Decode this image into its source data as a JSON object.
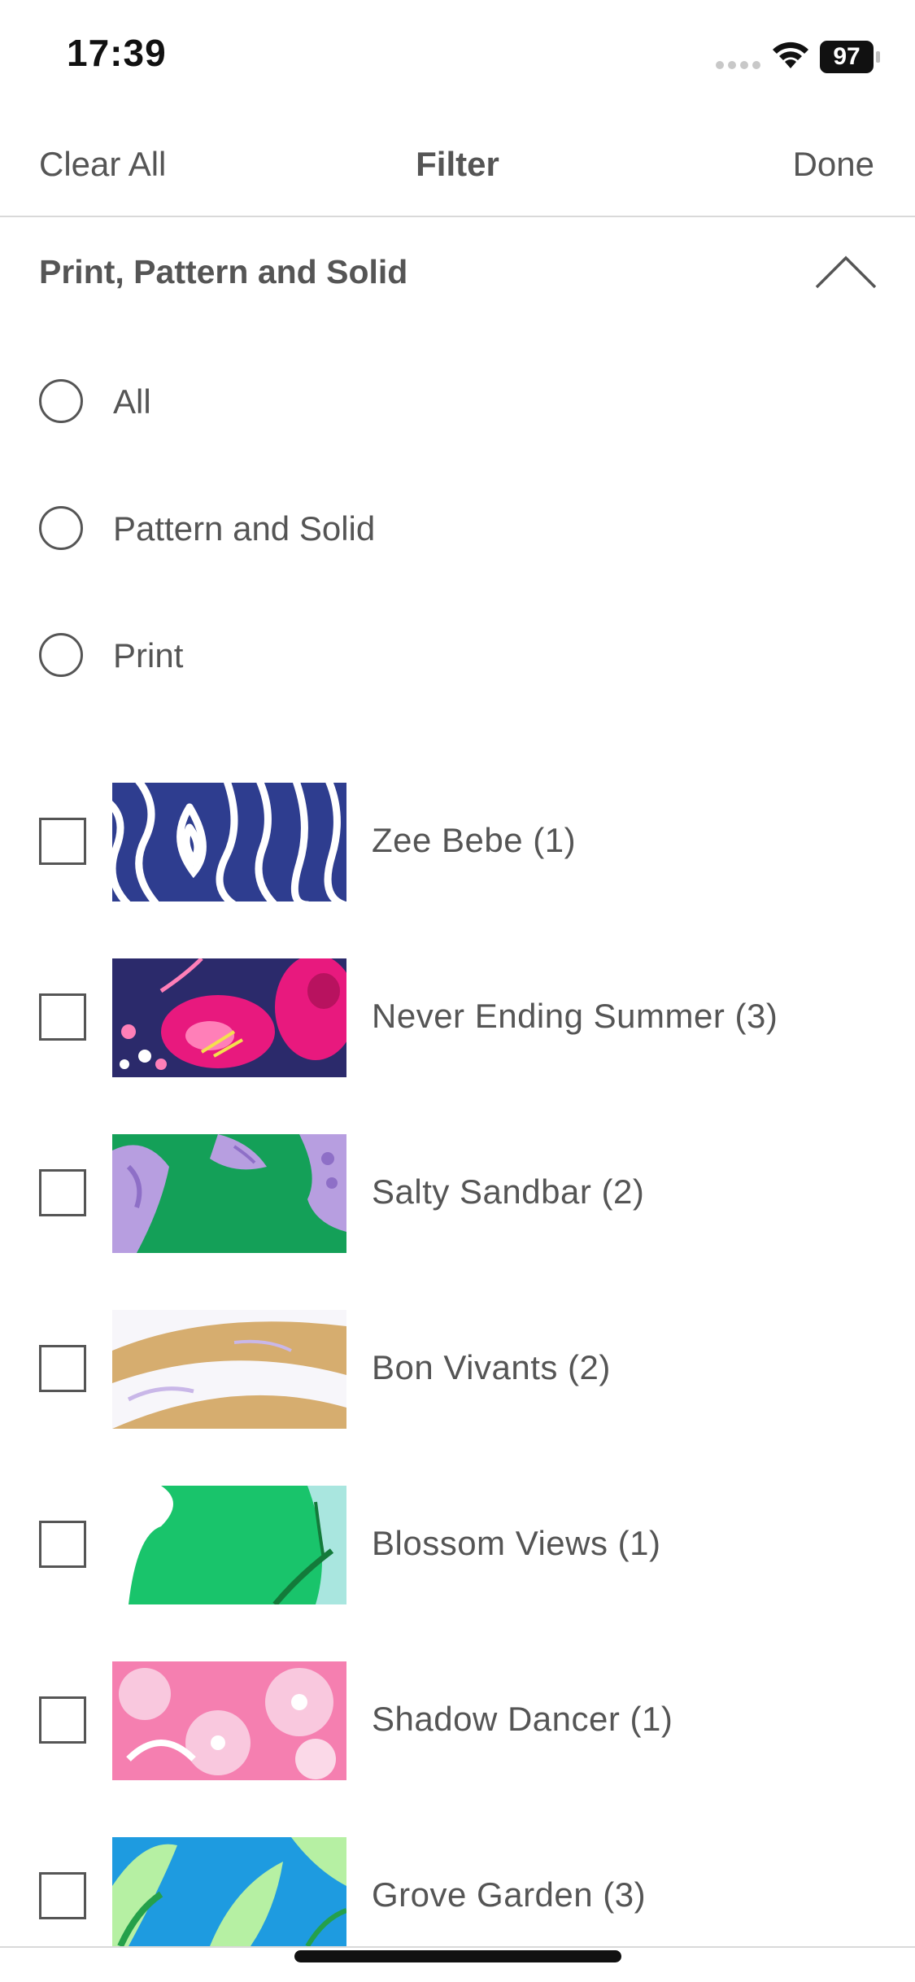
{
  "status_bar": {
    "time": "17:39",
    "battery": "97",
    "icons": [
      "signal-icon",
      "wifi-icon",
      "battery-icon"
    ]
  },
  "header": {
    "clear_label": "Clear All",
    "title": "Filter",
    "done_label": "Done"
  },
  "section": {
    "title": "Print, Pattern and Solid",
    "toggle_icon": "chevron-up-icon"
  },
  "radio_options": [
    {
      "label": "All"
    },
    {
      "label": "Pattern and Solid"
    },
    {
      "label": "Print"
    }
  ],
  "prints": [
    {
      "label": "Zee Bebe (1)",
      "colors": [
        "#2e3d8f",
        "#ffffff"
      ]
    },
    {
      "label": "Never Ending Summer (3)",
      "colors": [
        "#2b2a6b",
        "#e8197e",
        "#ff7fb8",
        "#f4e04d"
      ]
    },
    {
      "label": "Salty Sandbar (2)",
      "colors": [
        "#14a058",
        "#b79ee0",
        "#8e6fc7"
      ]
    },
    {
      "label": "Bon Vivants (2)",
      "colors": [
        "#d6ad6f",
        "#f7f6fa",
        "#c9b7e8"
      ]
    },
    {
      "label": "Blossom Views (1)",
      "colors": [
        "#19c46b",
        "#ffffff",
        "#a9e6df",
        "#137a3a"
      ]
    },
    {
      "label": "Shadow Dancer (1)",
      "colors": [
        "#f57fb0",
        "#f9c8de",
        "#ffffff"
      ]
    },
    {
      "label": "Grove Garden (3)",
      "colors": [
        "#1e9be0",
        "#b6f0a3",
        "#25a04a"
      ]
    }
  ]
}
